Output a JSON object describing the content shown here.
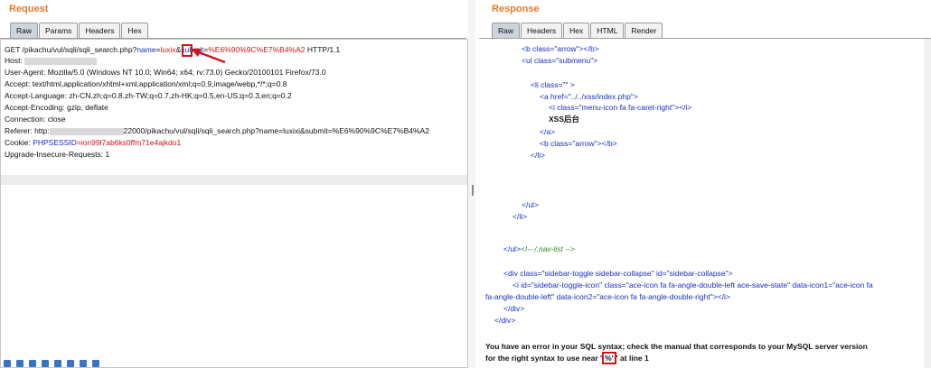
{
  "request": {
    "title": "Request",
    "tabs": [
      "Raw",
      "Params",
      "Headers",
      "Hex"
    ],
    "lines": {
      "get_prefix": "GET /pikachu/vul/sqli/sqli_search.php?",
      "param_name": "name",
      "eq1": "=",
      "param_name_val": "luxix",
      "amp": "&",
      "param_submit": "submit",
      "eq2": "=",
      "param_submit_val": "%E6%90%9C%E7%B4%A2",
      "http": " HTTP/1.1",
      "host": "Host:",
      "ua": "User-Agent: Mozilla/5.0 (Windows NT 10.0; Win64; x64; rv:73.0) Gecko/20100101 Firefox/73.0",
      "accept": "Accept: text/html,application/xhtml+xml,application/xml;q=0.9,image/webp,*/*;q=0.8",
      "accept_lang": "Accept-Language: zh-CN,zh;q=0.8,zh-TW;q=0.7,zh-HK;q=0.5,en-US;q=0.3,en;q=0.2",
      "accept_enc": "Accept-Encoding: gzip, deflate",
      "connection": "Connection: close",
      "referer_prefix": "Referer: http:",
      "referer_suffix": "22000/pikachu/vul/sqli/sqli_search.php?name=luxixi&submit=%E6%90%9C%E7%B4%A2",
      "cookie_label": "Cookie: ",
      "cookie_name": "PHPSESSID",
      "cookie_val": "=ion99l7ab6ks0ffm71e4ajkdo1",
      "upgrade": "Upgrade-Insecure-Requests: 1"
    }
  },
  "response": {
    "title": "Response",
    "tabs": [
      "Raw",
      "Headers",
      "Hex",
      "HTML",
      "Render"
    ],
    "code": {
      "l1": "<b class=\"arrow\"></b>",
      "l2": "<ul class=\"submenu\">",
      "l3": "<li class=\"\" >",
      "l4": "<a href=\"../../xss/index.php\">",
      "l5": "<i class=\"menu-icon fa fa-caret-right\"></i>",
      "l6": "XSS后台",
      "l7": "</a>",
      "l8": "<b class=\"arrow\"></b>",
      "l9": "</li>",
      "l10": "</ul>",
      "l11": "</li>",
      "l12_a": "</ul>",
      "l12_b": "<!-- /.nav-list -->",
      "l13": "<div class=\"sidebar-toggle sidebar-collapse\" id=\"sidebar-collapse\">",
      "l14": "<i id=\"sidebar-toggle-icon\" class=\"ace-icon fa fa-angle-double-left ace-save-state\" data-icon1=\"ace-icon fa",
      "l15": "fa-angle-double-left\" data-icon2=\"ace-icon fa fa-angle-double-right\"></i>",
      "l16": "</div>",
      "l17": "</div>"
    },
    "error_line1": "You have an error in your SQL syntax; check the manual that corresponds to your MySQL server version",
    "error_line2_a": "for the right syntax to use near '",
    "error_highlight": "%'",
    "error_line2_b": "' at line 1"
  },
  "colors": {
    "accent": "#e8782a",
    "highlight_red": "#d0151a",
    "param_blue": "#1a2fbf"
  }
}
